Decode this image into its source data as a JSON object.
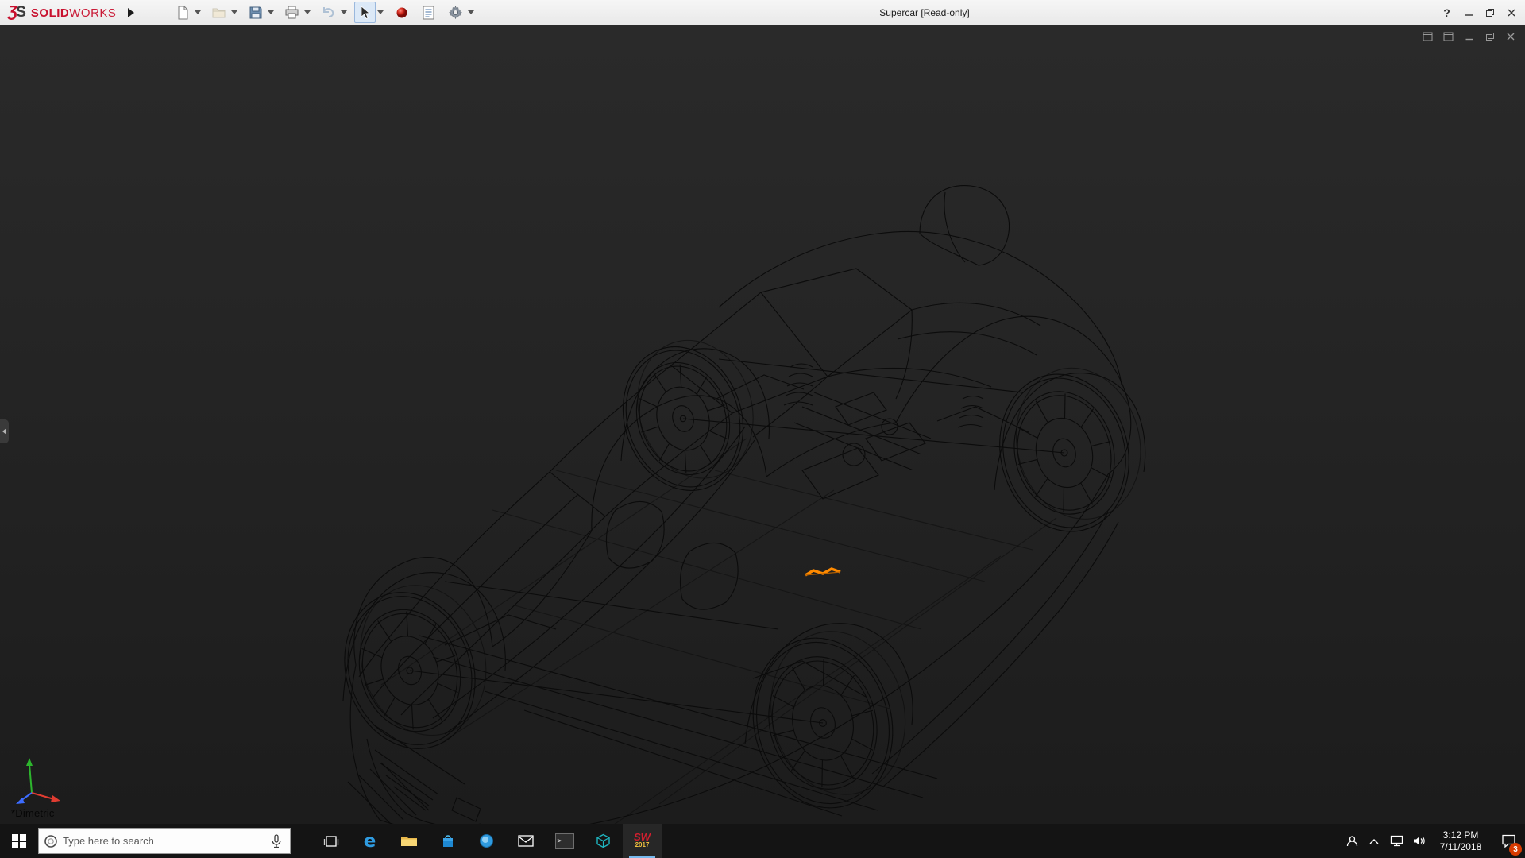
{
  "window": {
    "title": "Supercar [Read-only]",
    "help_glyph": "?"
  },
  "brand": {
    "mark_3": "Ʒ",
    "mark_s": "S",
    "name_bold": "SOLID",
    "name_light": "WORKS"
  },
  "toolbar": {
    "buttons": [
      {
        "name": "new-document",
        "enabled": true,
        "dropdown": true
      },
      {
        "name": "open",
        "enabled": false,
        "dropdown": true
      },
      {
        "name": "save",
        "enabled": true,
        "dropdown": true
      },
      {
        "name": "print",
        "enabled": true,
        "dropdown": true
      },
      {
        "name": "undo",
        "enabled": false,
        "dropdown": true
      },
      {
        "name": "select",
        "enabled": true,
        "dropdown": true,
        "active": true
      },
      {
        "name": "appearance-sphere",
        "enabled": true,
        "dropdown": false
      },
      {
        "name": "file-properties",
        "enabled": true,
        "dropdown": false
      },
      {
        "name": "options",
        "enabled": true,
        "dropdown": true
      }
    ]
  },
  "viewport": {
    "orientation_label": "*Dimetric",
    "highlight_color": "#ff8a00",
    "background": "#242424"
  },
  "taskbar": {
    "search_placeholder": "Type here to search",
    "edge_glyph": "e",
    "cmd_glyph": ">_",
    "solidworks_label": "SW",
    "solidworks_year": "2017",
    "apps": [
      "start",
      "cortana-search",
      "task-view",
      "edge",
      "file-explorer",
      "store",
      "browser",
      "mail",
      "command-prompt",
      "model-viewer",
      "solidworks-2017"
    ],
    "tray_time": "3:12 PM",
    "tray_date": "7/11/2018",
    "notification_count": "3"
  },
  "colors": {
    "menubar_bg": "#ededed",
    "brand_red": "#c8102e",
    "taskbar_bg": "#141414",
    "triad_x": "#e03c31",
    "triad_y": "#2db52d",
    "triad_z": "#3c6cff"
  }
}
